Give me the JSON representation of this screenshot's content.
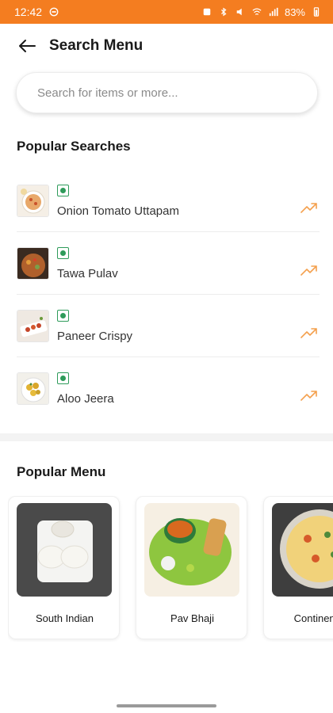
{
  "status_bar": {
    "time": "12:42",
    "battery": "83%",
    "background": "#f47d20"
  },
  "header": {
    "title": "Search Menu"
  },
  "search": {
    "placeholder": "Search for items or more..."
  },
  "popular_searches": {
    "title": "Popular Searches",
    "items": [
      {
        "name": "Onion Tomato Uttapam",
        "veg": true,
        "icon": "trending-up-icon"
      },
      {
        "name": "Tawa Pulav",
        "veg": true,
        "icon": "trending-up-icon"
      },
      {
        "name": "Paneer Crispy",
        "veg": true,
        "icon": "trending-up-icon"
      },
      {
        "name": "Aloo Jeera",
        "veg": true,
        "icon": "trending-up-icon"
      }
    ]
  },
  "popular_menu": {
    "title": "Popular Menu",
    "items": [
      {
        "label": "South Indian"
      },
      {
        "label": "Pav Bhaji"
      },
      {
        "label": "Continental"
      }
    ]
  },
  "colors": {
    "accent": "#f47d20",
    "veg_green": "#2e9b5a"
  }
}
